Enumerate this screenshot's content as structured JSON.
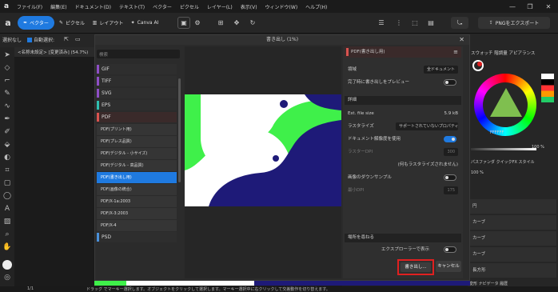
{
  "menubar": {
    "logo": "a",
    "items": [
      "ファイル(F)",
      "編集(E)",
      "ドキュメント(D)",
      "テキスト(T)",
      "ベクター",
      "ピクセル",
      "レイヤー(L)",
      "表示(V)",
      "ウィンドウ(W)",
      "ヘルプ(H)"
    ],
    "minimize": "—",
    "maximize": "❐",
    "close": "✕"
  },
  "topbar": {
    "vector": "ベクター",
    "pixel": "ピクセル",
    "layout": "レイアウト",
    "canva": "Canva AI",
    "export": "PNGをエクスポート"
  },
  "toolrow": {
    "no_selection": "選択なし",
    "auto_select": "自動選択:",
    "dialog_title": "書き出し (1%)"
  },
  "document": {
    "tab": "<名称未設定> [変更済み] (54.7%)"
  },
  "formats": {
    "search_placeholder": "検索",
    "items": [
      {
        "label": "GIF",
        "color": "#8e4ec6"
      },
      {
        "label": "TIFF",
        "color": "#8e4ec6"
      },
      {
        "label": "SVG",
        "color": "#8e4ec6"
      },
      {
        "label": "EPS",
        "color": "#2fbfb0"
      },
      {
        "label": "PDF",
        "color": "#d9534f"
      }
    ],
    "pdf_presets": [
      "PDF(プリント用)",
      "PDF(プレス品質)",
      "PDF(デジタル - 小サイズ)",
      "PDF(デジタル - 高品質)",
      "PDF(書き出し用)",
      "PDF(画像の統合)",
      "PDF/X-1a:2003",
      "PDF/X-3:2003",
      "PDF/X-4"
    ],
    "selected_preset": "PDF(書き出し用)",
    "psd": "PSD",
    "psd_color": "#4a90d9"
  },
  "settings": {
    "title": "PDF(書き出し用)",
    "area_label": "領域",
    "area_value": "全ドキュメント",
    "preview_label": "完了時に書き出しをプレビュー",
    "details_header": "詳細",
    "filesize_label": "Est. file size",
    "filesize_value": "5.9 kB",
    "rasterize_label": "ラスタライズ",
    "rasterize_value": "サポートされていないプロパティ",
    "docres_label": "ドキュメント解像度を使用",
    "raster_dpi_label": "ラスターDPI",
    "raster_dpi_value": "300",
    "rasterize_none": "(何もラスタライズされません)",
    "downsample_label": "画像のダウンサンプル",
    "min_dpi_label": "最小DPI",
    "min_dpi_value": "175",
    "more_header": "場所を尋ねる",
    "explorer_label": "エクスプローラーで表示",
    "export_button": "書き出し...",
    "cancel_button": "キャンセル"
  },
  "rightpanel": {
    "tabs": "スウォッチ 階調量 アピアランス",
    "hex": "FFFFFF",
    "opacity": "100 %",
    "layer_tabs": "パスファンダ クイックFX スタイル",
    "opacity2": "100 %",
    "layers": [
      "円",
      "カーブ",
      "カーブ",
      "カーブ",
      "長方形"
    ],
    "bottom_tabs": "変形 ナビゲータ 履歴"
  },
  "statusbar": {
    "page": "1/1",
    "hint": "ドラッグ でマーキー選択します。オブジェクトをクリックして選択します。マーキー選択中に右クリックして交差動作を切り替えます。"
  },
  "colors": {
    "accent": "#1f7ae0",
    "highlight_red": "#e02020",
    "navy": "#1e1a78",
    "green": "#3ff04a"
  }
}
